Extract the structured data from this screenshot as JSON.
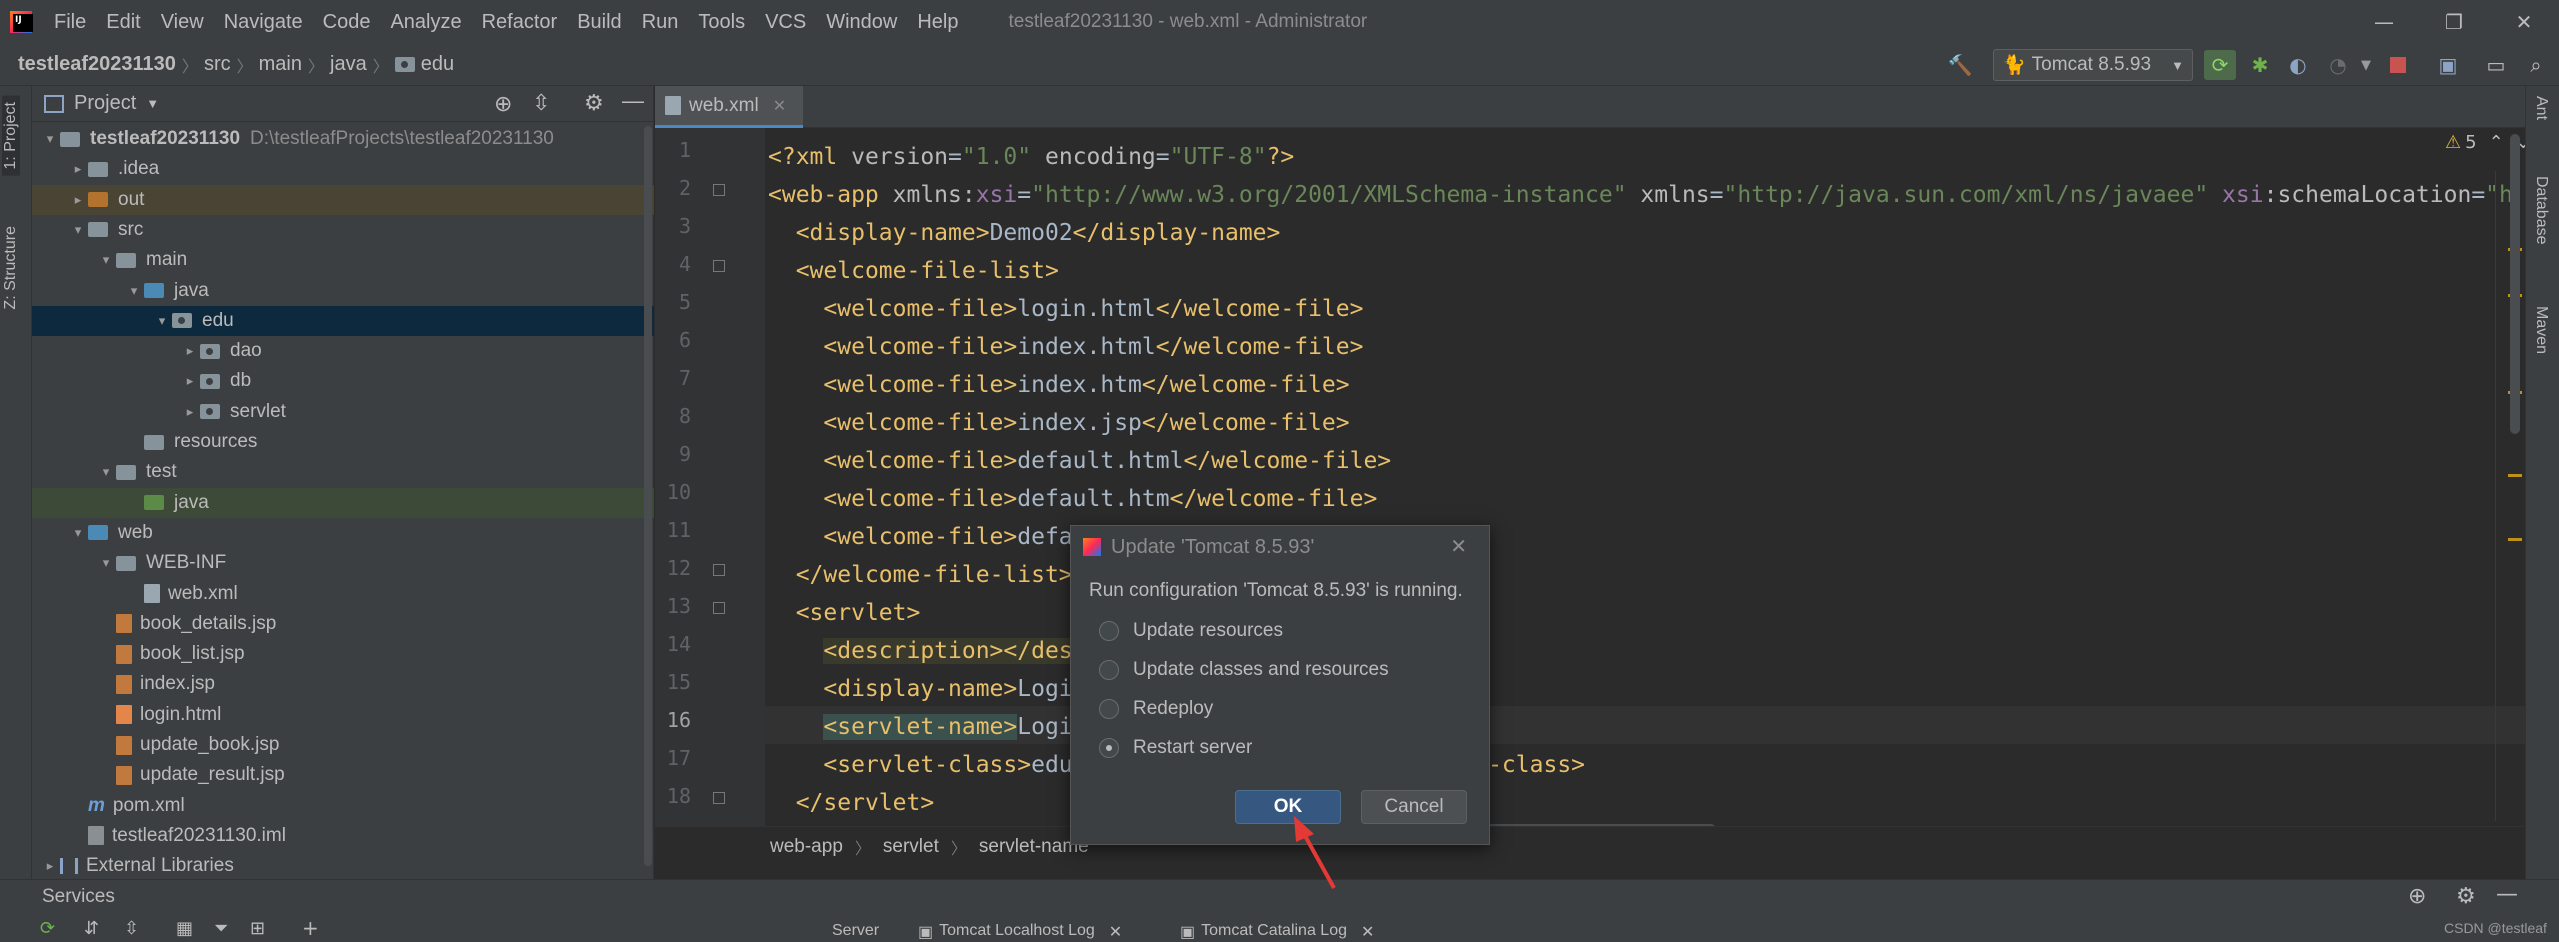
{
  "menubar": {
    "items": [
      "File",
      "Edit",
      "View",
      "Navigate",
      "Code",
      "Analyze",
      "Refactor",
      "Build",
      "Run",
      "Tools",
      "VCS",
      "Window",
      "Help"
    ],
    "window_title": "testleaf20231130 - web.xml - Administrator"
  },
  "navbar": {
    "crumbs": [
      "testleaf20231130",
      "src",
      "main",
      "java",
      "edu"
    ],
    "run_config": "Tomcat 8.5.93"
  },
  "left_tabs": {
    "project": "1: Project",
    "structure": "Z: Structure"
  },
  "right_tabs": {
    "ant": "Ant",
    "database": "Database",
    "maven": "Maven"
  },
  "project_panel": {
    "title": "Project",
    "tree": [
      {
        "label": "testleaf20231130",
        "sub": "D:\\testleafProjects\\testleaf20231130",
        "level": 0,
        "arrow": "▾",
        "icon": "folder",
        "bold": true
      },
      {
        "label": ".idea",
        "level": 1,
        "arrow": "▸",
        "icon": "folder"
      },
      {
        "label": "out",
        "level": 1,
        "arrow": "▸",
        "icon": "folder-orange",
        "highlight": "out"
      },
      {
        "label": "src",
        "level": 1,
        "arrow": "▾",
        "icon": "folder"
      },
      {
        "label": "main",
        "level": 2,
        "arrow": "▾",
        "icon": "folder"
      },
      {
        "label": "java",
        "level": 3,
        "arrow": "▾",
        "icon": "folder-blue"
      },
      {
        "label": "edu",
        "level": 4,
        "arrow": "▾",
        "icon": "package",
        "highlight": "selected"
      },
      {
        "label": "dao",
        "level": 5,
        "arrow": "▸",
        "icon": "package"
      },
      {
        "label": "db",
        "level": 5,
        "arrow": "▸",
        "icon": "package"
      },
      {
        "label": "servlet",
        "level": 5,
        "arrow": "▸",
        "icon": "package"
      },
      {
        "label": "resources",
        "level": 3,
        "arrow": "",
        "icon": "folder"
      },
      {
        "label": "test",
        "level": 2,
        "arrow": "▾",
        "icon": "folder"
      },
      {
        "label": "java",
        "level": 3,
        "arrow": "",
        "icon": "folder-green",
        "highlight": "test"
      },
      {
        "label": "web",
        "level": 1,
        "arrow": "▾",
        "icon": "folder-blue"
      },
      {
        "label": "WEB-INF",
        "level": 2,
        "arrow": "▾",
        "icon": "folder"
      },
      {
        "label": "web.xml",
        "level": 3,
        "arrow": "",
        "icon": "xml"
      },
      {
        "label": "book_details.jsp",
        "level": 2,
        "arrow": "",
        "icon": "jsp"
      },
      {
        "label": "book_list.jsp",
        "level": 2,
        "arrow": "",
        "icon": "jsp"
      },
      {
        "label": "index.jsp",
        "level": 2,
        "arrow": "",
        "icon": "jsp"
      },
      {
        "label": "login.html",
        "level": 2,
        "arrow": "",
        "icon": "html"
      },
      {
        "label": "update_book.jsp",
        "level": 2,
        "arrow": "",
        "icon": "jsp"
      },
      {
        "label": "update_result.jsp",
        "level": 2,
        "arrow": "",
        "icon": "jsp"
      },
      {
        "label": "pom.xml",
        "level": 1,
        "arrow": "",
        "icon": "maven"
      },
      {
        "label": "testleaf20231130.iml",
        "level": 1,
        "arrow": "",
        "icon": "iml"
      },
      {
        "label": "External Libraries",
        "level": 0,
        "arrow": "▸",
        "icon": "library"
      }
    ]
  },
  "editor": {
    "tab": "web.xml",
    "warning_count": "5",
    "line_numbers": [
      "1",
      "2",
      "3",
      "4",
      "5",
      "6",
      "7",
      "8",
      "9",
      "10",
      "11",
      "12",
      "13",
      "14",
      "15",
      "16",
      "17",
      "18"
    ],
    "breadcrumb": [
      "web-app",
      "servlet",
      "servlet-name"
    ]
  },
  "dialog": {
    "title": "Update 'Tomcat 8.5.93'",
    "message": "Run configuration 'Tomcat 8.5.93' is running.",
    "options": [
      "Update resources",
      "Update classes and resources",
      "Redeploy",
      "Restart server"
    ],
    "selected_option": "Restart server",
    "ok": "OK",
    "cancel": "Cancel"
  },
  "services": {
    "title": "Services",
    "tabs": [
      "Server",
      "Tomcat Localhost Log",
      "Tomcat Catalina Log"
    ]
  },
  "watermark": "CSDN @testleaf",
  "colors": {
    "accent": "#4a88c7",
    "selection": "#0d293e",
    "ok_button": "#365880",
    "arrow_annotation": "#e53935"
  }
}
